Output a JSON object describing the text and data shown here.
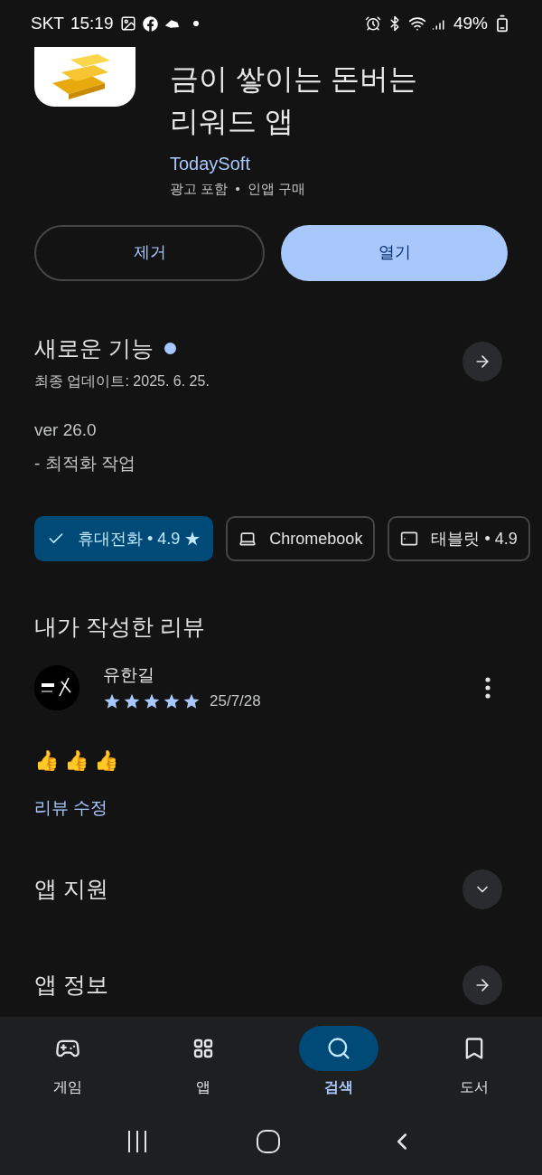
{
  "status_bar": {
    "carrier": "SKT",
    "time": "15:19",
    "battery": "49%"
  },
  "app": {
    "title_lines": [
      "금이 쌓이는 돈버는",
      "리워드 앱"
    ],
    "developer": "TodaySoft",
    "meta": "광고 포함  •  인앱 구매"
  },
  "buttons": [
    {
      "label": "제거",
      "kind": "outline"
    },
    {
      "label": "열기",
      "kind": "filled"
    }
  ],
  "whats_new": {
    "title": "새로운 기능",
    "updated": "최종 업데이트: 2025. 6. 25.",
    "version": "ver 26.0",
    "notes": "- 최적화 작업"
  },
  "devices": [
    {
      "label": "휴대전화 • 4.9 ★",
      "kind": "phone",
      "selected": true
    },
    {
      "label": "Chromebook",
      "kind": "laptop",
      "selected": false
    },
    {
      "label": "태블릿 • 4.9",
      "kind": "tablet",
      "selected": false
    }
  ],
  "review": {
    "heading": "내가 작성한 리뷰",
    "author": "유한길",
    "stars": 5,
    "date": "25/7/28",
    "body": "👍👍👍",
    "edit_link": "리뷰 수정"
  },
  "sections": [
    {
      "title": "앱 지원",
      "kind": "expand"
    },
    {
      "title": "앱 정보",
      "kind": "arrow"
    }
  ],
  "nav": [
    {
      "label": "게임",
      "kind": "games",
      "selected": false
    },
    {
      "label": "앱",
      "kind": "apps",
      "selected": false
    },
    {
      "label": "검색",
      "kind": "search",
      "selected": true
    },
    {
      "label": "도서",
      "kind": "books",
      "selected": false
    }
  ]
}
